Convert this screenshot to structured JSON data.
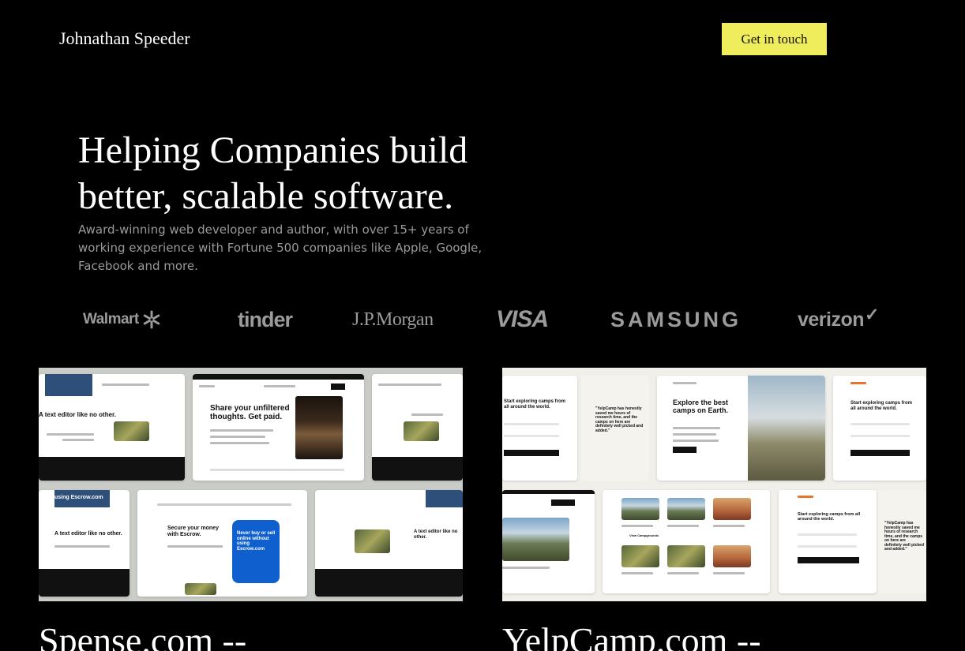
{
  "header": {
    "brand": "Johnathan Speeder",
    "cta_label": "Get in touch",
    "cta_color": "#f0ed5c"
  },
  "hero": {
    "headline": "Helping Companies build better, scalable software.",
    "subtext": "Award-winning web developer and author, with over 15+ years of working experience with Fortune 500 companies like Apple, Google, Facebook and more."
  },
  "logos": [
    {
      "name": "Walmart",
      "icon": "walmart-spark-icon"
    },
    {
      "name": "tinder"
    },
    {
      "name": "J.P.Morgan"
    },
    {
      "name": "VISA"
    },
    {
      "name": "SAMSUNG"
    },
    {
      "name": "verizon",
      "icon": "verizon-check-icon"
    }
  ],
  "projects": [
    {
      "title": "Spense.com --",
      "thumb": {
        "hero_heading": "Share your unfiltered thoughts. Get paid.",
        "secure_heading": "Secure your money with Escrow.",
        "phone_heading": "Never buy or sell online without using Escrow.com",
        "editor_heading": "A text editor like no other.",
        "banner_heading": "using Escrow.com"
      }
    },
    {
      "title": "YelpCamp.com --",
      "thumb": {
        "explore_heading": "Explore the best camps on Earth.",
        "start_heading": "Start exploring camps from all around the world.",
        "quote": "\"YelpCamp has honestly saved me hours of research time, and the camps on here are definitely well picked and added.\"",
        "cta": "View Campgrounds"
      }
    }
  ]
}
